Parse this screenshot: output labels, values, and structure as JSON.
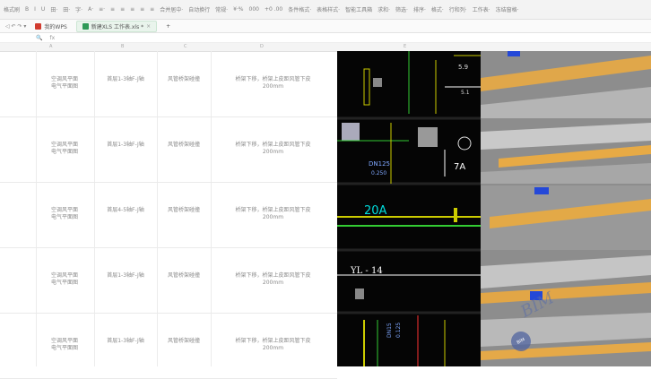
{
  "toolbar": {
    "items": [
      "格式刷",
      "B",
      "I",
      "U",
      "田·",
      "田·",
      "字·",
      "A·",
      "≡·",
      "≡",
      "≡",
      "≡",
      "≡",
      "≡",
      "合并居中·",
      "自动换行",
      "常规·",
      "¥·%",
      "000",
      "+0 .00",
      "条件格式·",
      "表格样式·",
      "智能工具箱",
      "求和·",
      "筛选·",
      "排序·",
      "格式·",
      "行和列·",
      "工作表·",
      "冻结窗格·"
    ]
  },
  "tabs": {
    "wps_label": "我的WPS",
    "file_label": "新建XLS 工作表.xls *",
    "add": "+"
  },
  "formula": {
    "fx": "fx"
  },
  "columns": [
    "A",
    "B",
    "C",
    "D",
    "E"
  ],
  "rows": [
    {
      "c1": "空调风平面\n电气平面图",
      "c2": "首层1-3轴F-J轴",
      "c3": "风管桥架碰撞",
      "c4": "桥架下移，桥架上皮距风管下皮\n200mm"
    },
    {
      "c1": "空调风平面\n电气平面图",
      "c2": "首层1-3轴F-J轴",
      "c3": "风管桥架碰撞",
      "c4": "桥架下移，桥架上皮距风管下皮\n200mm"
    },
    {
      "c1": "空调风平面\n电气平面图",
      "c2": "首层4-5轴F-J轴",
      "c3": "风管桥架碰撞",
      "c4": "桥架下移，桥架上皮距风管下皮\n200mm"
    },
    {
      "c1": "空调风平面\n电气平面图",
      "c2": "首层1-3轴F-J轴",
      "c3": "风管桥架碰撞",
      "c4": "桥架下移，桥架上皮距风管下皮\n200mm"
    },
    {
      "c1": "空调风平面\n电气平面图",
      "c2": "首层1-3轴F-J轴",
      "c3": "风管桥架碰撞",
      "c4": "桥架下移，桥架上皮距风管下皮\n200mm"
    }
  ],
  "cad": {
    "labels": [
      "DN125",
      "0.250",
      "7A",
      "20A",
      "YL - 14",
      "5.9",
      "5.1",
      "DN15",
      "0.125"
    ]
  },
  "watermark": {
    "text": "BIM",
    "badge": "BIM"
  }
}
